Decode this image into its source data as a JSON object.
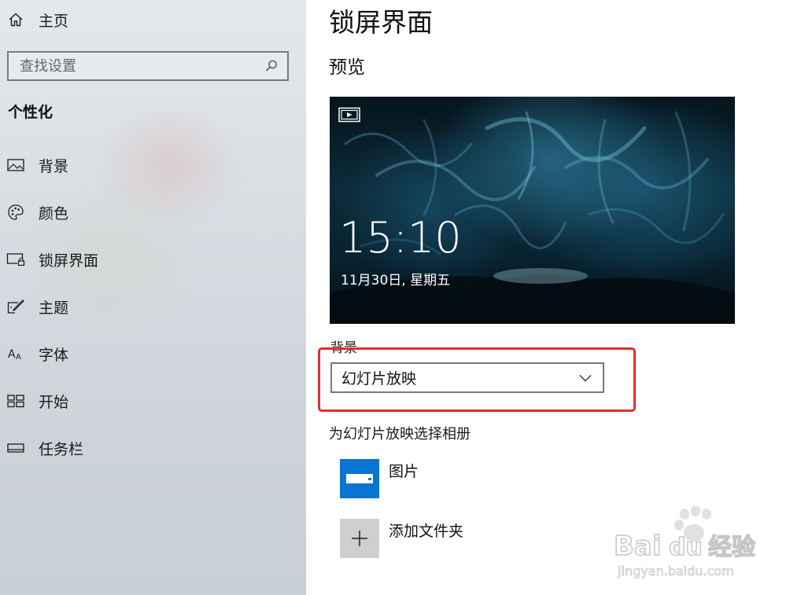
{
  "sidebar": {
    "home_label": "主页",
    "search": {
      "placeholder": "查找设置"
    },
    "section_title": "个性化",
    "items": [
      {
        "label": "背景",
        "icon": "image-icon"
      },
      {
        "label": "颜色",
        "icon": "palette-icon"
      },
      {
        "label": "锁屏界面",
        "icon": "lock-screen-icon"
      },
      {
        "label": "主题",
        "icon": "theme-brush-icon"
      },
      {
        "label": "字体",
        "icon": "font-icon"
      },
      {
        "label": "开始",
        "icon": "start-icon"
      },
      {
        "label": "任务栏",
        "icon": "taskbar-icon"
      }
    ]
  },
  "main": {
    "title": "锁屏界面",
    "preview_heading": "预览",
    "preview": {
      "time": "15:10",
      "date": "11月30日, 星期五"
    },
    "background_label": "背景",
    "background_dropdown": {
      "value": "幻灯片放映"
    },
    "album_heading": "为幻灯片放映选择相册",
    "albums": [
      {
        "label": "图片",
        "icon": "pictures-folder-icon"
      },
      {
        "label": "添加文件夹",
        "icon": "plus-icon"
      }
    ]
  },
  "watermark": {
    "brand": "Baidu经验",
    "url": "jingyan.baidu.com"
  },
  "colors": {
    "accent": "#0a74d3",
    "highlight_border": "#e2302c",
    "add_tile": "#cfcfcf"
  }
}
